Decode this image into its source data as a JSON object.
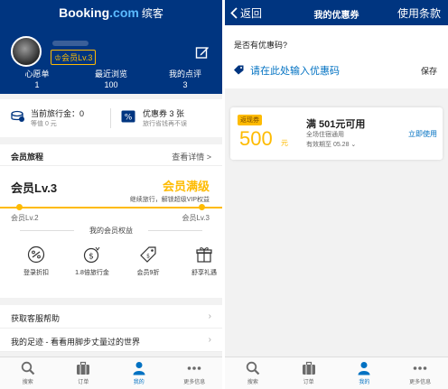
{
  "left": {
    "brand": {
      "part1": "Booking",
      "part2": ".com",
      "part3": "缤客"
    },
    "level_badge": "会员Lv.3",
    "stats": [
      {
        "label": "心愿单",
        "value": "1"
      },
      {
        "label": "最近浏览",
        "value": "100"
      },
      {
        "label": "我的点评",
        "value": "3"
      }
    ],
    "travel_credit": {
      "title": "当前旅行金：0",
      "sub": "等值 0 元"
    },
    "coupons": {
      "title": "优惠券 3 张",
      "sub": "旅行省钱再不误"
    },
    "journey": {
      "title": "会员旅程",
      "link": "查看详情 >"
    },
    "level_card": {
      "level": "会员Lv.3",
      "status": "会员满级",
      "sub": "继续旅行，解锁超级VIP权益",
      "from": "会员Lv.2",
      "to": "会员Lv.3",
      "benefits_title": "我的会员权益",
      "benefits": [
        {
          "label": "登录折扣",
          "icon": "discount-icon"
        },
        {
          "label": "1.8倍旅行金",
          "icon": "coins-icon"
        },
        {
          "label": "会员9折",
          "icon": "tag-icon"
        },
        {
          "label": "舒享礼遇",
          "icon": "gift-icon"
        }
      ]
    },
    "list": [
      {
        "label": "获取客服帮助"
      },
      {
        "label": "我的足迹 - 看看用脚步丈量过的世界"
      }
    ]
  },
  "right": {
    "back": "返回",
    "title": "我的优惠券",
    "terms": "使用条款",
    "code_question": "是否有优惠码?",
    "code_placeholder": "请在此处输入优惠码",
    "save": "保存",
    "voucher": {
      "tag": "返现券",
      "amount": "500",
      "unit": "元",
      "title": "满 501元可用",
      "scope": "全场住宿通用",
      "expiry": "有效期至 05.28",
      "action": "立即使用"
    }
  },
  "tabs": [
    {
      "label": "搜索",
      "icon": "search-icon"
    },
    {
      "label": "订单",
      "icon": "briefcase-icon"
    },
    {
      "label": "我的",
      "icon": "person-icon"
    },
    {
      "label": "更多信息",
      "icon": "more-icon"
    }
  ],
  "colors": {
    "brand_blue": "#003580",
    "accent_yellow": "#febb02",
    "link_blue": "#0071c2"
  }
}
